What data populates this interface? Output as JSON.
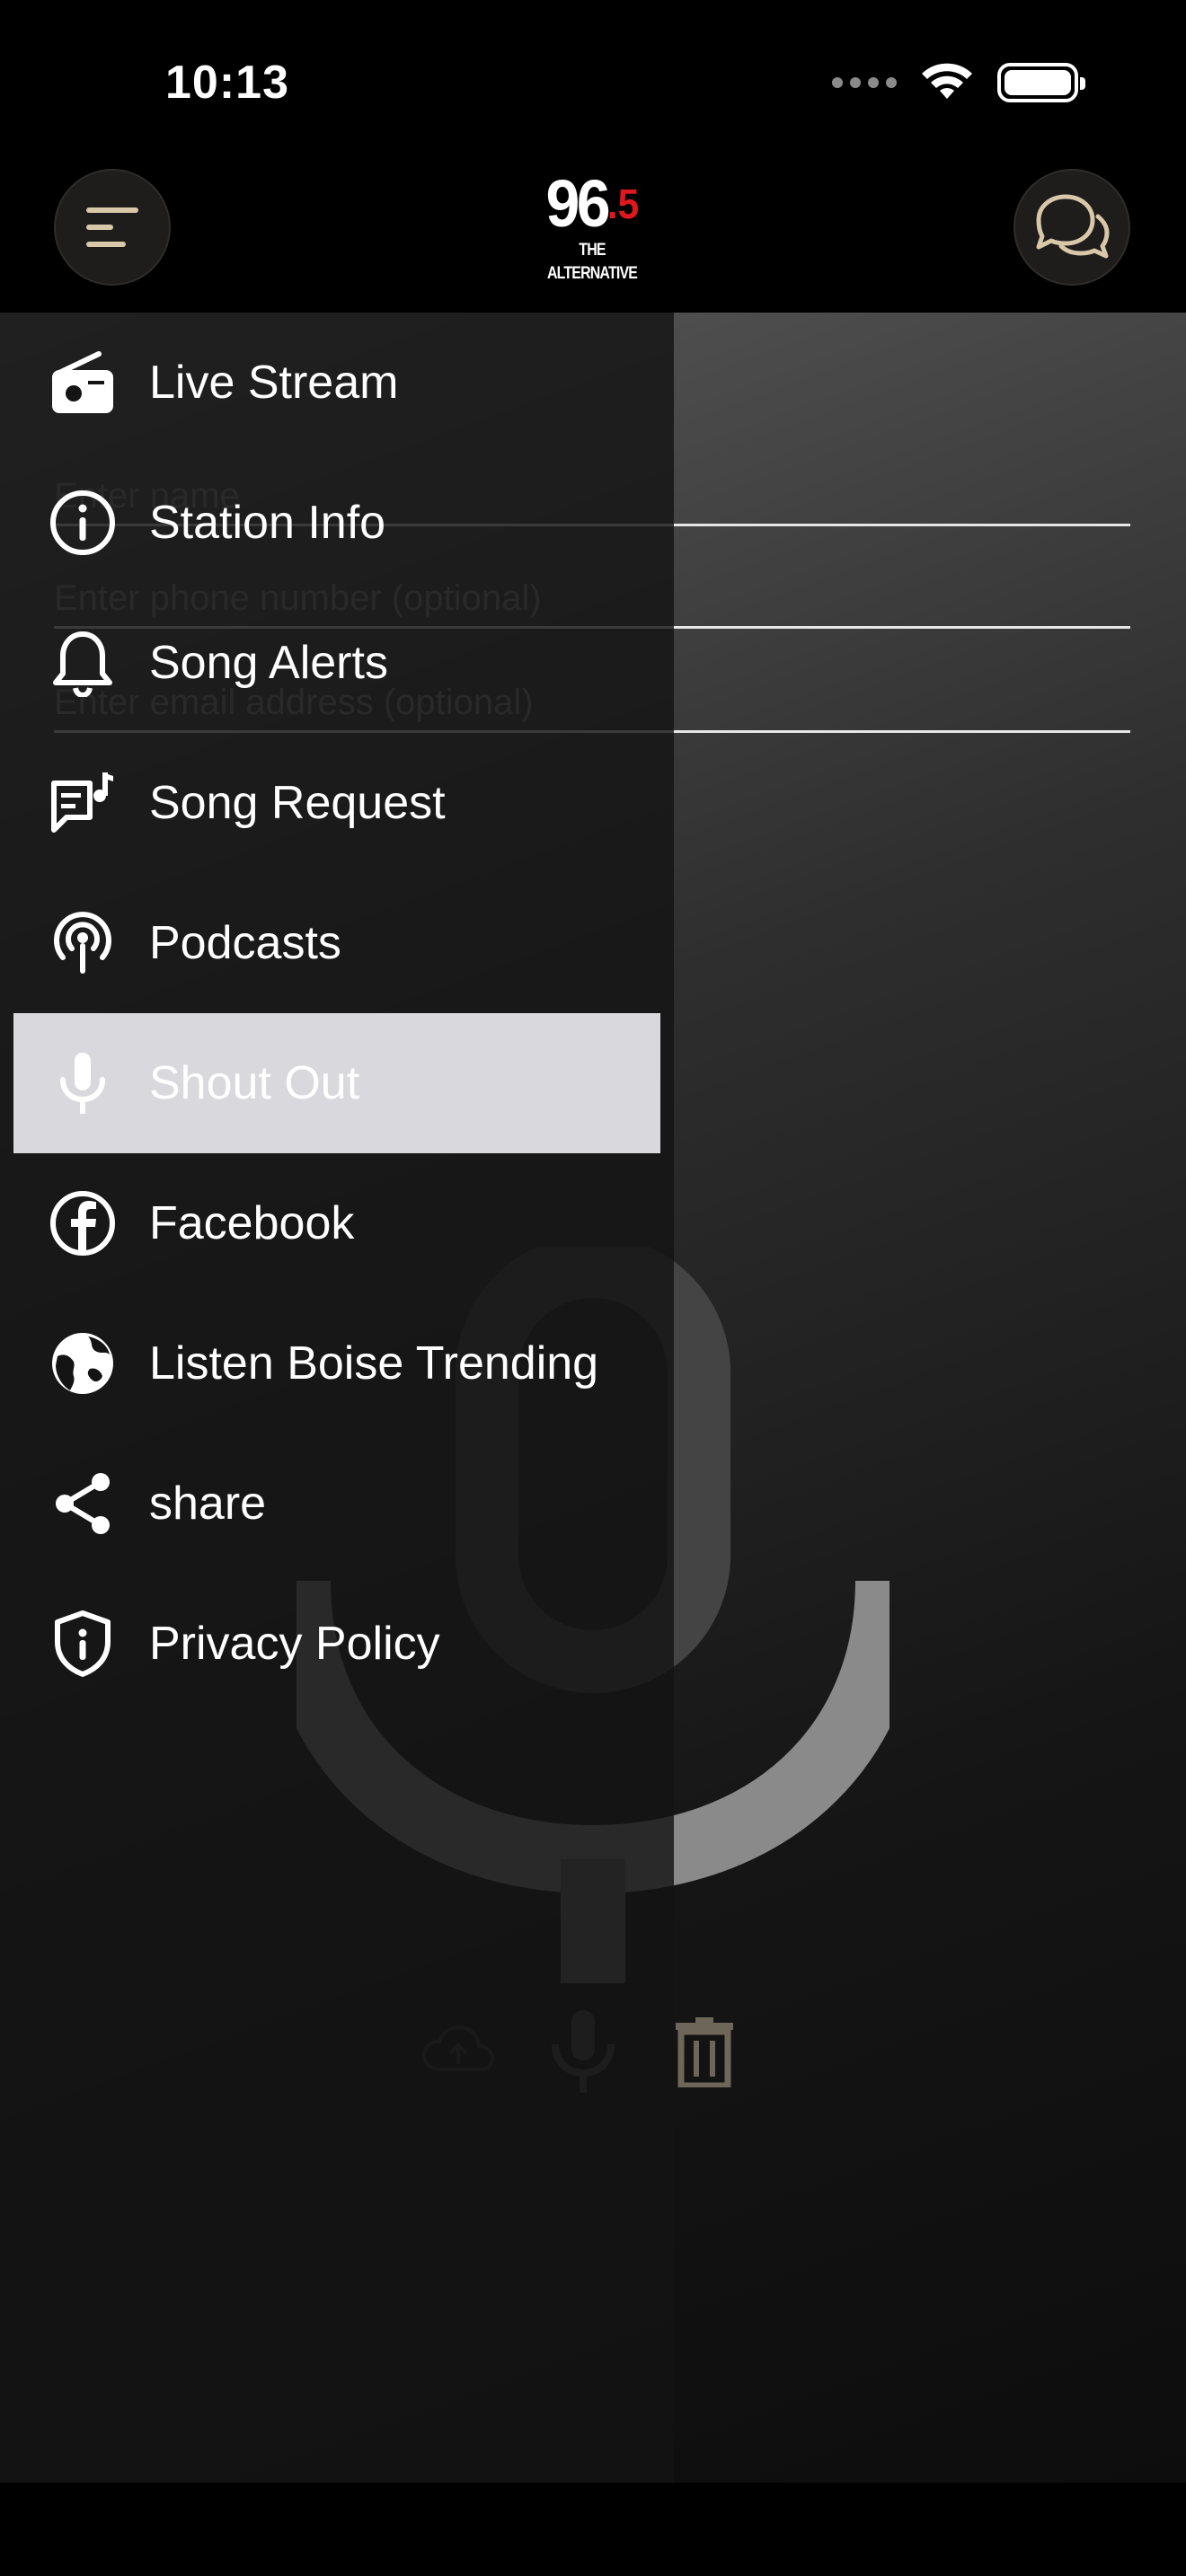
{
  "status_bar": {
    "time": "10:13"
  },
  "header": {
    "logo": {
      "number": "96",
      "decimal": ".5",
      "tagline": "THE ALTERNATIVE"
    },
    "menu_icon": "menu-icon",
    "chat_icon": "chat-icon"
  },
  "form": {
    "name_placeholder": "Enter name",
    "phone_placeholder": "Enter phone number (optional)",
    "email_placeholder": "Enter email address (optional)"
  },
  "recorder": {
    "upload_icon": "cloud-upload-icon",
    "record_icon": "microphone-icon",
    "delete_icon": "trash-icon"
  },
  "drawer": {
    "items": [
      {
        "label": "Live Stream",
        "icon": "radio-icon"
      },
      {
        "label": "Station Info",
        "icon": "info-icon"
      },
      {
        "label": "Song Alerts",
        "icon": "bell-icon"
      },
      {
        "label": "Song Request",
        "icon": "music-request-icon"
      },
      {
        "label": "Podcasts",
        "icon": "podcast-icon"
      },
      {
        "label": "Shout Out",
        "icon": "microphone-icon",
        "active": true
      },
      {
        "label": "Facebook",
        "icon": "facebook-icon"
      },
      {
        "label": "Listen Boise Trending",
        "icon": "globe-icon"
      },
      {
        "label": "share",
        "icon": "share-icon"
      },
      {
        "label": "Privacy Policy",
        "icon": "shield-icon"
      }
    ]
  },
  "colors": {
    "accent_gold": "#d8c7a8",
    "active_bg": "#d9d8dd",
    "brand_red": "#e0181e"
  }
}
